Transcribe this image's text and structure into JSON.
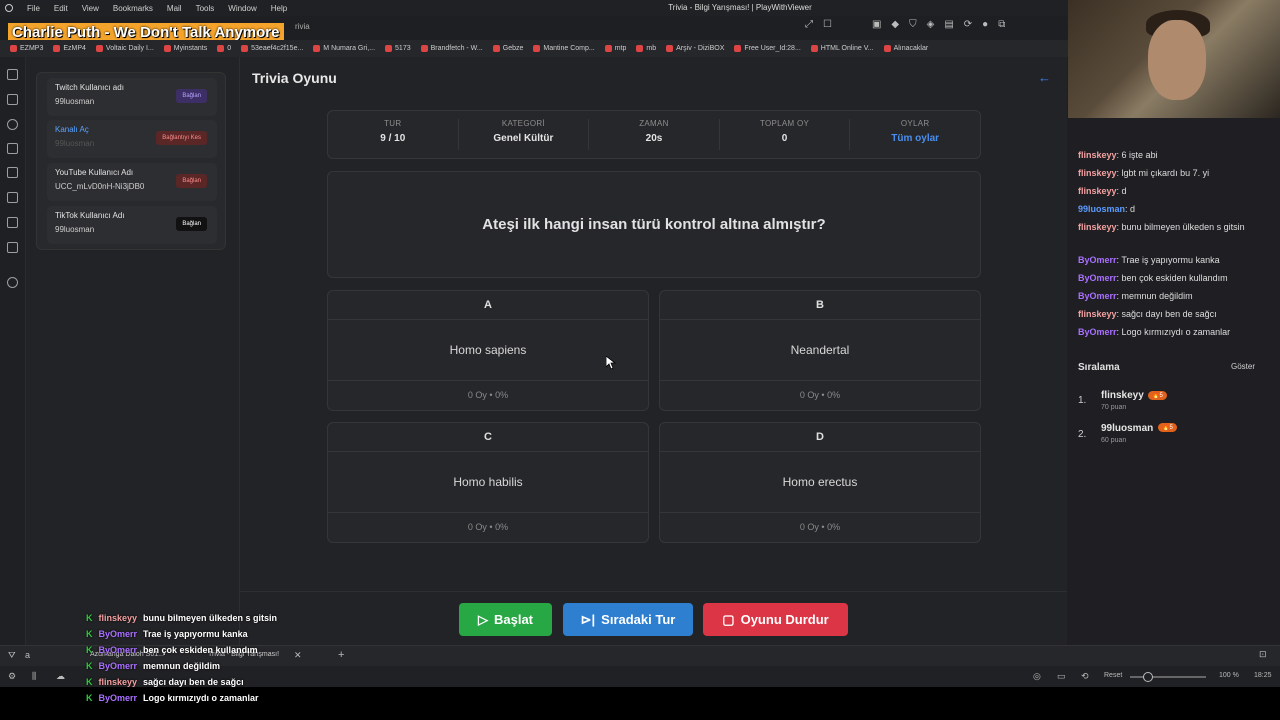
{
  "browser": {
    "menu": [
      "File",
      "Edit",
      "View",
      "Bookmarks",
      "Mail",
      "Tools",
      "Window",
      "Help"
    ],
    "window_title": "Trivia - Bilgi Yarışması! | PlayWithViewer",
    "music_overlay": "Charlie Puth - We Don't Talk Anymore",
    "url_fragment": "rivia",
    "bookmarks": [
      "EZMP3",
      "EzMP4",
      "Voltaic Daily I...",
      "Myinstants",
      "0",
      "53eaef4c2f15e...",
      "M Numara Gri,...",
      "5173",
      "Brandfetch - W...",
      "Gebze",
      "Mantine Comp...",
      "mtp",
      "mb",
      "Arşiv - DiziBOX",
      "Free User_Id:28...",
      "HTML Online V...",
      "Alınacaklar"
    ],
    "tabs": [
      "Azumanga Daioh S01...",
      "Trivia - Bilgi Yarışması!"
    ],
    "status_right": {
      "reset": "Reset",
      "zoom": "100 %",
      "time": "18:25"
    },
    "status_left_letter": "a"
  },
  "accounts": [
    {
      "title": "Twitch Kullanıcı adı",
      "value": "99luosman",
      "button": "Bağlan",
      "color": "#6b4fbb"
    },
    {
      "title": "Kanalı Aç",
      "value": "99luosman",
      "button": "Bağlantıyı Kes",
      "color": "#b83a3a"
    },
    {
      "title": "YouTube Kullanıcı Adı",
      "value": "UCC_mLvD0nH-Ni3jDB0",
      "button": "Bağlan",
      "color": "#b83a3a"
    },
    {
      "title": "TikTok Kullanıcı Adı",
      "value": "99luosman",
      "button": "Bağlan",
      "color": "#111111"
    }
  ],
  "game": {
    "title": "Trivia Oyunu",
    "stats": [
      {
        "label": "TUR",
        "value": "9 / 10"
      },
      {
        "label": "KATEGORİ",
        "value": "Genel Kültür"
      },
      {
        "label": "ZAMAN",
        "value": "20s"
      },
      {
        "label": "TOPLAM OY",
        "value": "0"
      },
      {
        "label": "OYLAR",
        "value": "Tüm oylar"
      }
    ],
    "question": "Ateşi ilk hangi insan türü kontrol altına almıştır?",
    "options": [
      {
        "letter": "A",
        "text": "Homo sapiens",
        "votes": "0 Oy • 0%"
      },
      {
        "letter": "B",
        "text": "Neandertal",
        "votes": "0 Oy • 0%"
      },
      {
        "letter": "C",
        "text": "Homo habilis",
        "votes": "0 Oy • 0%"
      },
      {
        "letter": "D",
        "text": "Homo erectus",
        "votes": "0 Oy • 0%"
      }
    ],
    "buttons": {
      "start": "Başlat",
      "next": "Sıradaki Tur",
      "stop": "Oyunu Durdur"
    }
  },
  "chat": [
    {
      "user": "flinskeyy",
      "msg": "6 işte abi",
      "color": "#f4a0a0"
    },
    {
      "user": "flinskeyy",
      "msg": "lgbt mi çıkardı bu 7. yi",
      "color": "#f4a0a0"
    },
    {
      "user": "flinskeyy",
      "msg": "d",
      "color": "#f4a0a0"
    },
    {
      "user": "99luosman",
      "msg": "d",
      "color": "#5b9bff"
    },
    {
      "user": "flinskeyy",
      "msg": "bunu bilmeyen ülkeden s gitsin",
      "color": "#f4a0a0"
    },
    {
      "user": "ByOmerr",
      "msg": "Trae iş yapıyormu kanka",
      "color": "#a970ff"
    },
    {
      "user": "ByOmerr",
      "msg": "ben çok eskiden kullandım",
      "color": "#a970ff"
    },
    {
      "user": "ByOmerr",
      "msg": "memnun değildim",
      "color": "#a970ff"
    },
    {
      "user": "flinskeyy",
      "msg": "sağcı dayı ben de sağcı",
      "color": "#f4a0a0"
    },
    {
      "user": "ByOmerr",
      "msg": "Logo kırmızıydı o zamanlar",
      "color": "#a970ff"
    }
  ],
  "ranking": {
    "title": "Sıralama",
    "show": "Göster",
    "items": [
      {
        "rank": "1.",
        "name": "flinskeyy",
        "badge": "🔥5",
        "points": "70 puan"
      },
      {
        "rank": "2.",
        "name": "99luosman",
        "badge": "🔥5",
        "points": "60 puan"
      }
    ]
  },
  "overlay_chat": [
    {
      "user": "flinskeyy",
      "msg": "bunu bilmeyen ülkeden s gitsin",
      "color": "#f4a0a0"
    },
    {
      "user": "ByOmerr",
      "msg": "Trae iş yapıyormu kanka",
      "color": "#a970ff"
    },
    {
      "user": "ByOmerr",
      "msg": "ben çok eskiden kullandım",
      "color": "#a970ff"
    },
    {
      "user": "ByOmerr",
      "msg": "memnun değildim",
      "color": "#a970ff"
    },
    {
      "user": "flinskeyy",
      "msg": "sağcı dayı ben de sağcı",
      "color": "#f4a0a0"
    },
    {
      "user": "ByOmerr",
      "msg": "Logo kırmızıydı o zamanlar",
      "color": "#a970ff"
    }
  ]
}
